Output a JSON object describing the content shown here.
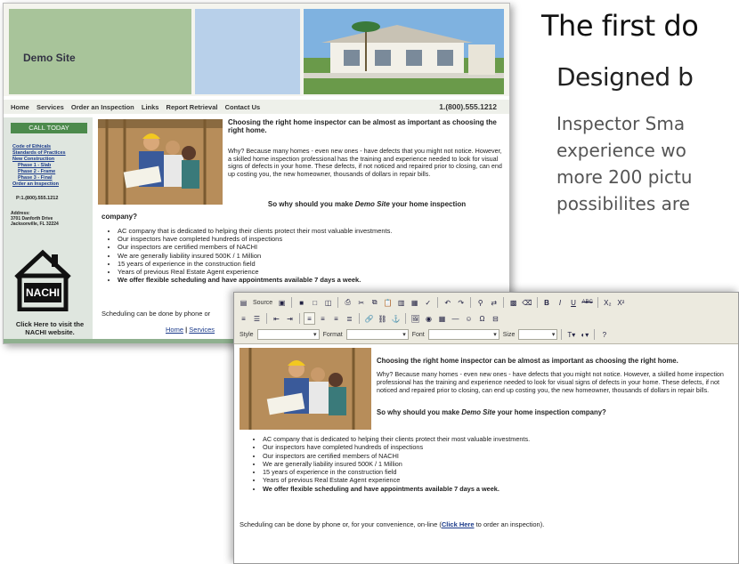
{
  "headline": {
    "title": "The first do",
    "subtitle": "Designed b",
    "blurb_lines": [
      "Inspector Sma",
      "experience wo",
      "more 200 pictu",
      "possibilites are"
    ]
  },
  "site": {
    "logo": "Demo Site",
    "nav": [
      "Home",
      "Services",
      "Order an Inspection",
      "Links",
      "Report Retrieval",
      "Contact Us"
    ],
    "phone": "1.(800).555.1212",
    "sidebar": {
      "call_today": "CALL TODAY",
      "links": [
        "Code of Ethicals",
        "Standards of Practices",
        "New Construction",
        "Phase 1 - Slab",
        "Phase 2 - Frame",
        "Phase 3 - Final",
        "Order an Inspection"
      ],
      "phone": "P:1.(800).555.1212",
      "address_label": "Address:",
      "address_line1": "3701 Danforth Drive",
      "address_line2": "Jacksonville, FL 32224",
      "nachi_logo": "NACHI",
      "nachi_caption": "Click Here to visit the NACHI website."
    },
    "main": {
      "heading": "Choosing the right home inspector can be almost as important as choosing the right home.",
      "para": "Why? Because many homes - even new ones - have defects that you might not notice. However, a skilled home inspection professional has the training and experience needed to look for visual signs of defects in your home. These defects, if not noticed and repaired prior to closing, can end up costing you, the new homeowner, thousands of dollars in repair bills.",
      "subheading_a": "So why should you make ",
      "subheading_site": "Demo Site",
      "subheading_b": " your home inspection",
      "subheading_cont": "company?",
      "bullets": [
        "AC company that is dedicated to helping their clients protect their most valuable investments.",
        "Our inspectors have completed hundreds of inspections",
        "Our inspectors are certified members of NACHI",
        "We are generally liability insured 500K / 1 Million",
        "15 years of experience in the construction field",
        "Years of previous Real Estate Agent experience",
        "We offer flexible scheduling and have appointments available 7 days a week."
      ],
      "schedule": "Scheduling can be done by phone or",
      "footer_home": "Home",
      "footer_services": "Services",
      "footer_sep": " | "
    }
  },
  "editor": {
    "toolbar": {
      "source": "Source",
      "style_label": "Style",
      "format_label": "Format",
      "font_label": "Font",
      "size_label": "Size",
      "bold": "B",
      "italic": "I",
      "underline": "U",
      "strike": "ABC",
      "subscript": "X₂",
      "superscript": "X²"
    },
    "heading": "Choosing the right home inspector can be almost as important as choosing the right home.",
    "para": "Why? Because many homes - even new ones - have defects that you might not notice. However, a skilled home inspection professional has the training and experience needed to look for visual signs of defects in your home. These defects, if not noticed and repaired prior to closing, can end up costing you, the new homeowner, thousands of dollars in repair bills.",
    "sub_a": "So why should you make ",
    "sub_site": "Demo Site",
    "sub_b": " your home inspection company?",
    "schedule_a": "Scheduling can be done by phone or, for your convenience, on-line (",
    "schedule_link": "Click Here",
    "schedule_b": " to order an inspection)."
  }
}
